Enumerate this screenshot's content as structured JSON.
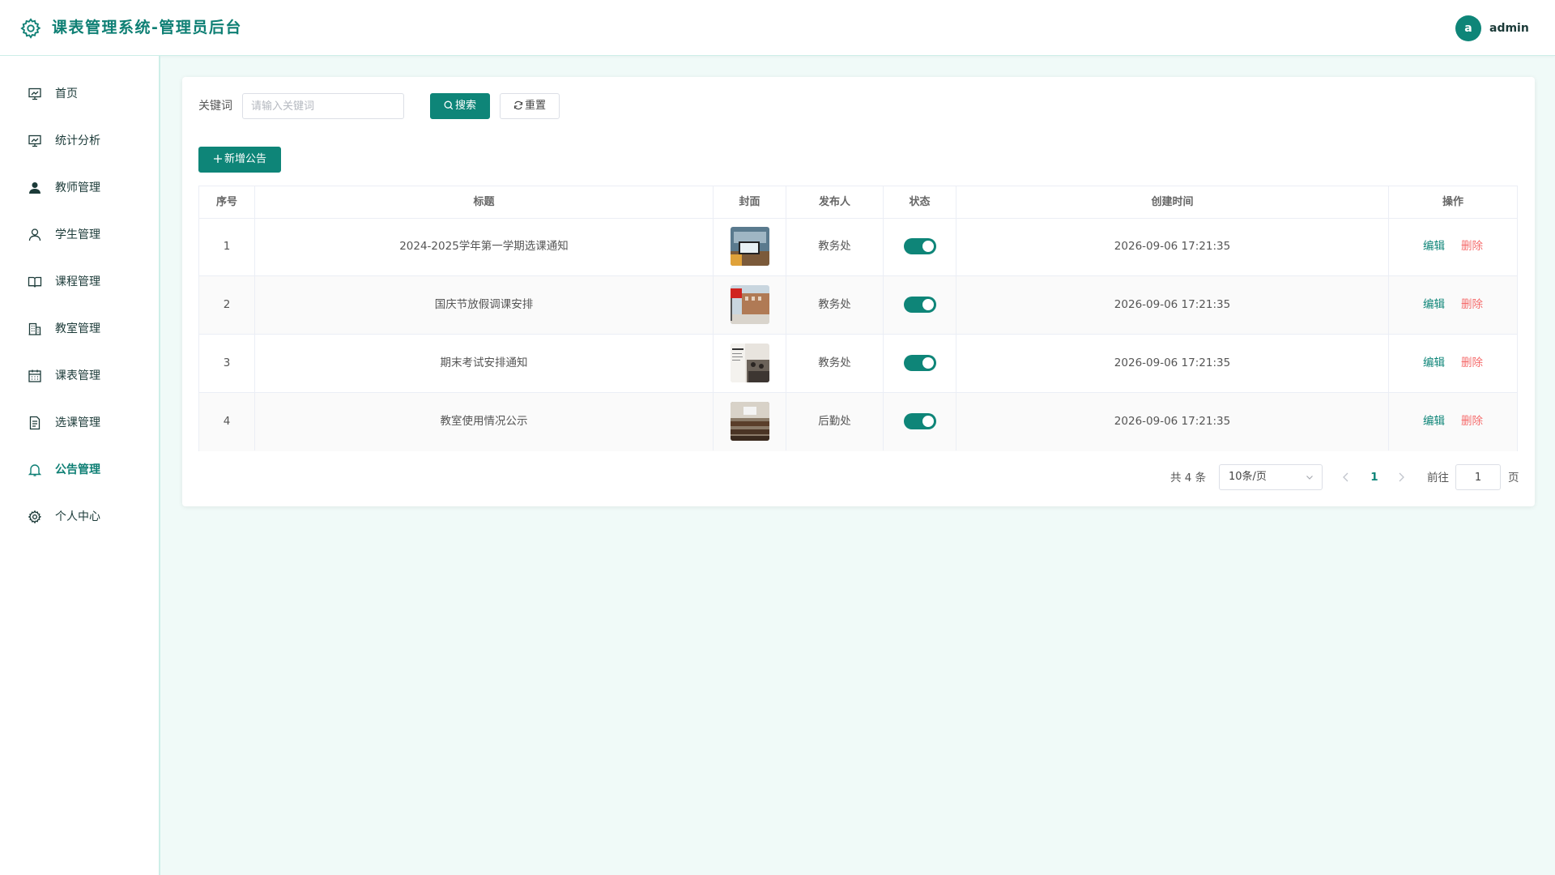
{
  "header": {
    "title": "课表管理系统-管理员后台",
    "avatar_letter": "a",
    "username": "admin"
  },
  "sidebar": {
    "items": [
      {
        "label": "首页",
        "icon": "presentation-icon"
      },
      {
        "label": "统计分析",
        "icon": "presentation-icon"
      },
      {
        "label": "教师管理",
        "icon": "user-filled-icon"
      },
      {
        "label": "学生管理",
        "icon": "user-icon"
      },
      {
        "label": "课程管理",
        "icon": "book-icon"
      },
      {
        "label": "教室管理",
        "icon": "building-icon"
      },
      {
        "label": "课表管理",
        "icon": "calendar-icon"
      },
      {
        "label": "选课管理",
        "icon": "document-icon"
      },
      {
        "label": "公告管理",
        "icon": "bell-icon"
      },
      {
        "label": "个人中心",
        "icon": "gear-icon"
      }
    ],
    "active": "公告管理"
  },
  "search": {
    "label": "关键词",
    "placeholder": "请输入关键词",
    "search_button": "搜索",
    "reset_button": "重置"
  },
  "toolbar": {
    "add_button": "新增公告"
  },
  "table": {
    "columns": [
      "序号",
      "标题",
      "封面",
      "发布人",
      "状态",
      "创建时间",
      "操作"
    ],
    "rows": [
      {
        "index": "1",
        "title": "2024-2025学年第一学期选课通知",
        "cover": "laptop-photo",
        "publisher": "教务处",
        "status": true,
        "created": "2026-09-06 17:21:35"
      },
      {
        "index": "2",
        "title": "国庆节放假调课安排",
        "cover": "flag-building-photo",
        "publisher": "教务处",
        "status": true,
        "created": "2026-09-06 17:21:35"
      },
      {
        "index": "3",
        "title": "期末考试安排通知",
        "cover": "exam-hall-photo",
        "publisher": "教务处",
        "status": true,
        "created": "2026-09-06 17:21:35"
      },
      {
        "index": "4",
        "title": "教室使用情况公示",
        "cover": "classroom-photo",
        "publisher": "后勤处",
        "status": true,
        "created": "2026-09-06 17:21:35"
      }
    ],
    "actions": {
      "edit": "编辑",
      "delete": "删除"
    }
  },
  "pagination": {
    "total_text": "共 4 条",
    "page_size": "10条/页",
    "current_page": "1",
    "goto_prefix": "前往",
    "goto_value": "1",
    "goto_suffix": "页"
  },
  "colors": {
    "primary": "#0e8578",
    "title": "#0e7f74",
    "danger": "#f56c6c",
    "background": "#f0faf8"
  }
}
